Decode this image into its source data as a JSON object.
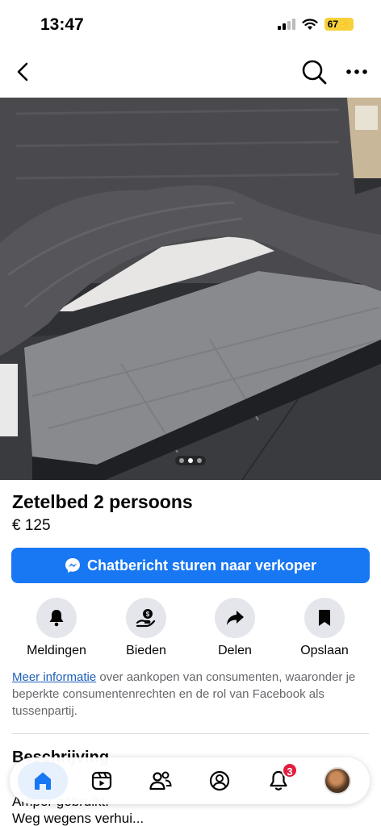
{
  "status_bar": {
    "time": "13:47",
    "battery": "67"
  },
  "listing": {
    "title": "Zetelbed 2 persoons",
    "price": "€ 125",
    "chat_button_label": "Chatbericht sturen naar verkoper"
  },
  "actions": [
    {
      "label": "Meldingen",
      "icon": "bell-icon"
    },
    {
      "label": "Bieden",
      "icon": "offer-icon"
    },
    {
      "label": "Delen",
      "icon": "share-icon"
    },
    {
      "label": "Opslaan",
      "icon": "bookmark-icon"
    }
  ],
  "info": {
    "link_text": "Meer informatie",
    "rest_text": " over aankopen van consumenten, waaronder je beperkte consumentenrechten en de rol van Facebook als tussenpartij."
  },
  "partial_content": {
    "section_heading": "Beschrijving",
    "line1": "Amper gebruikt.",
    "line2": "Weg wegens verhui..."
  },
  "carousel": {
    "count": 3,
    "active_index": 1
  },
  "tab_bar": {
    "items": [
      "home-icon",
      "video-icon",
      "friends-icon",
      "marketplace-icon",
      "notifications-icon",
      "profile-avatar"
    ],
    "notification_badge": "3"
  },
  "colors": {
    "accent": "#1877f2",
    "badge": "#e41e3f"
  }
}
